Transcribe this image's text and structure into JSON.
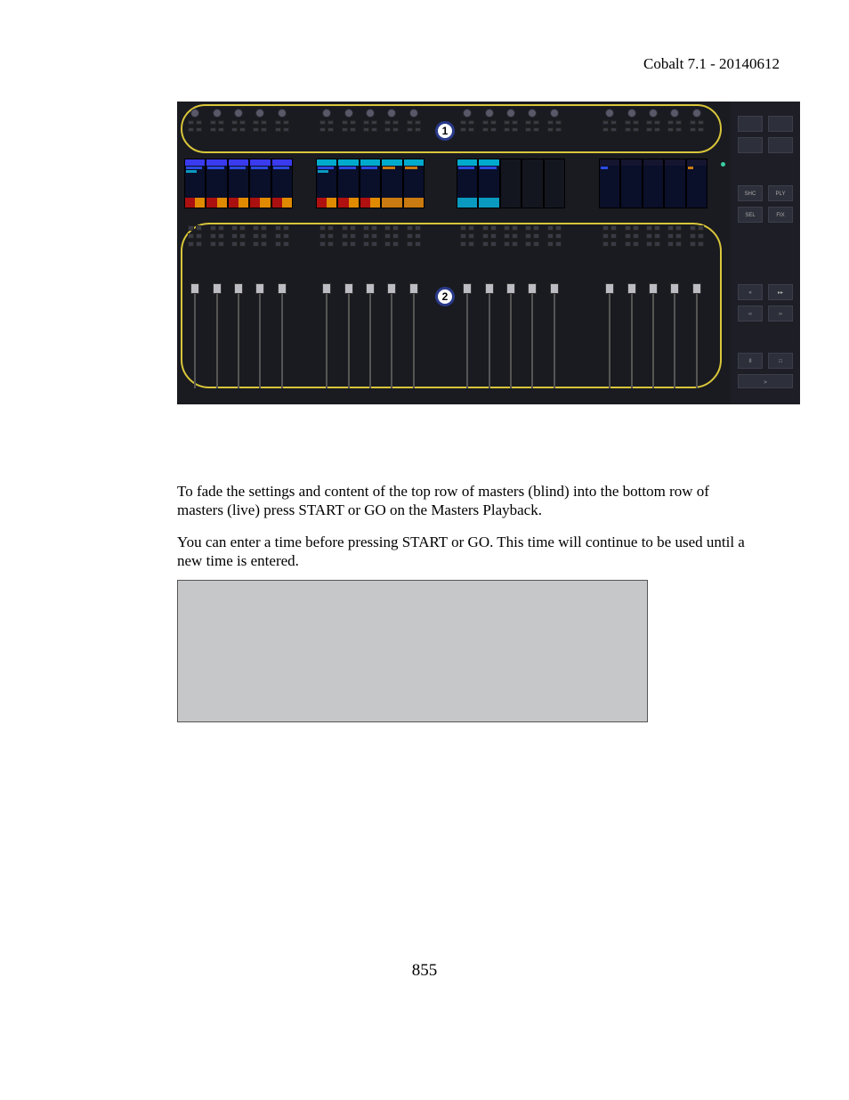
{
  "header": {
    "title": "Cobalt 7.1 - 20140612"
  },
  "callouts": {
    "one": "1",
    "two": "2"
  },
  "sidebar": {
    "row1": [
      "",
      ""
    ],
    "row1b": [
      "",
      ""
    ],
    "row2": [
      "SHC",
      "PLY"
    ],
    "row2b": [
      "SEL",
      "FIX"
    ],
    "row3": [
      "«",
      "▸▸"
    ],
    "row3b": [
      "‹‹",
      "››"
    ],
    "row4": [
      "II",
      "□"
    ],
    "row4go": ">"
  },
  "body": {
    "p1": "To fade the settings and content of the top row of masters (blind) into the bottom row of masters (live) press START or GO on the Masters Playback.",
    "p2": "You can enter a time before pressing START or GO. This time will continue to be used until a new time is entered."
  },
  "page": {
    "number": "855"
  }
}
